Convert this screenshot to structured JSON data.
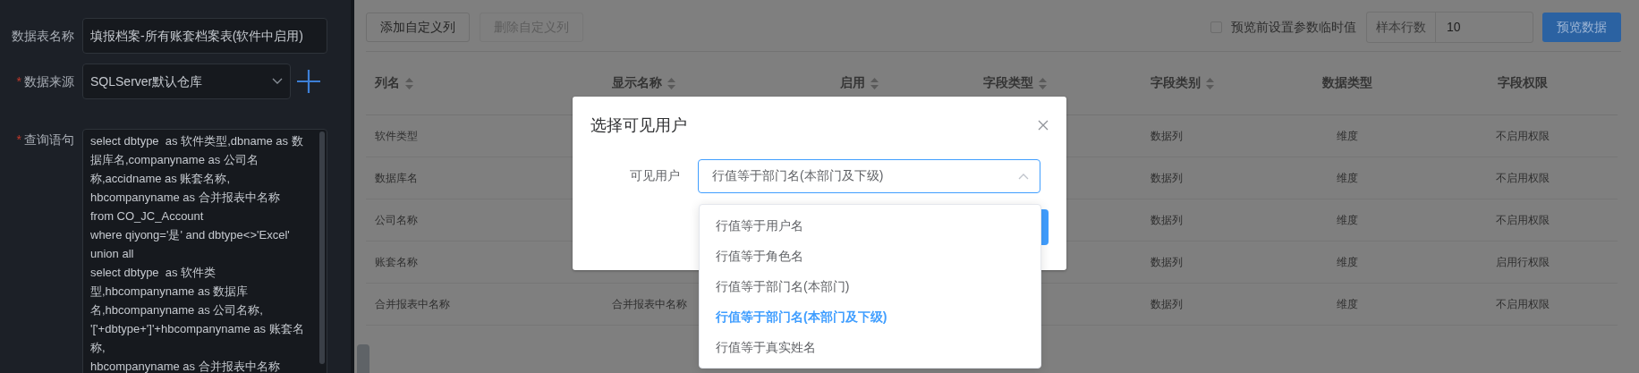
{
  "form": {
    "fields": [
      {
        "label": "数据表名称",
        "kind": "input",
        "value": "填报档案-所有账套档案表(软件中启用)"
      },
      {
        "label": "数据来源",
        "required_mark": "*",
        "kind": "select",
        "value": "SQLServer默认仓库"
      },
      {
        "label": "查询语句",
        "required_mark": "*",
        "kind": "textarea",
        "value": "select dbtype  as 软件类型,dbname as 数据库名,companyname as 公司名称,accidname as 账套名称,\nhbcompanyname as 合并报表中名称\nfrom CO_JC_Account\nwhere qiyong='是' and dbtype<>'Excel'\nunion all\nselect dbtype  as 软件类型,hbcompanyname as 数据库名,hbcompanyname as 公司名称,\n'['+dbtype+']'+hbcompanyname as 账套名称,\nhbcompanyname as 合并报表中名称"
      }
    ]
  },
  "toolbar": {
    "buttons": [
      {
        "label": "添加自定义列",
        "disabled": false
      },
      {
        "label": "删除自定义列",
        "disabled": true
      }
    ],
    "preview_option": {
      "label": "预览前设置参数临时值",
      "checked": false
    },
    "sample_rows": {
      "label": "样本行数",
      "value": "10"
    },
    "preview_button": "预览数据"
  },
  "table": {
    "columns": [
      {
        "label": "列名",
        "sortable": true
      },
      {
        "label": "显示名称",
        "sortable": true
      },
      {
        "label": "启用",
        "sortable": true
      },
      {
        "label": "字段类型",
        "sortable": true
      },
      {
        "label": "字段类别",
        "sortable": true
      },
      {
        "label": "数据类型",
        "sortable": false
      },
      {
        "label": "字段权限",
        "sortable": false
      }
    ],
    "rows": [
      {
        "column_name": "软件类型",
        "field_category": "数据列",
        "data_type": "维度",
        "permission": "不启用权限"
      },
      {
        "column_name": "数据库名",
        "field_category": "数据列",
        "data_type": "维度",
        "permission": "不启用权限"
      },
      {
        "column_name": "公司名称",
        "field_category": "数据列",
        "data_type": "维度",
        "permission": "不启用权限"
      },
      {
        "column_name": "账套名称",
        "field_category": "数据列",
        "data_type": "维度",
        "permission": "启用行权限"
      },
      {
        "column_name": "合并报表中名称",
        "display_name": "合并报表中名称",
        "field_category": "数据列",
        "data_type": "维度",
        "permission": "不启用权限"
      }
    ]
  },
  "modal": {
    "title": "选择可见用户",
    "field_label": "可见用户",
    "value": "行值等于部门名(本部门及下级)",
    "open": true,
    "options": [
      {
        "label": "行值等于用户名",
        "selected": false
      },
      {
        "label": "行值等于角色名",
        "selected": false
      },
      {
        "label": "行值等于部门名(本部门)",
        "selected": false
      },
      {
        "label": "行值等于部门名(本部门及下级)",
        "selected": true
      },
      {
        "label": "行值等于真实姓名",
        "selected": false
      }
    ]
  }
}
